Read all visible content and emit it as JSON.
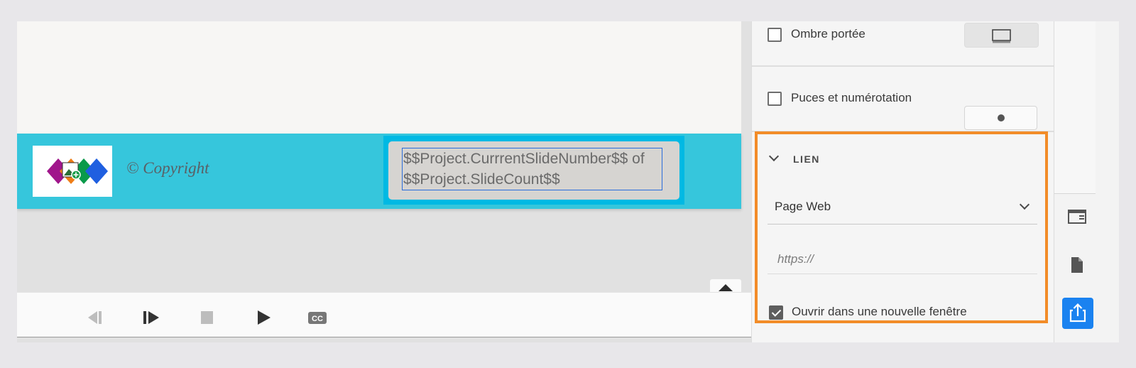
{
  "slide": {
    "copyright": "© Copyright",
    "slide_number_text": "$$Project.CurrrentSlideNumber$$ of $$Project.SlideCount$$"
  },
  "playbar": {
    "buttons": [
      "rewind-icon",
      "play-pause-icon",
      "stop-icon",
      "play-icon",
      "closed-caption-icon"
    ],
    "cc_label": "CC"
  },
  "panel": {
    "shadow": {
      "label": "Ombre portée",
      "checked": false
    },
    "bullets": {
      "label": "Puces et numérotation",
      "checked": false
    },
    "link": {
      "title": "LIEN",
      "type_value": "Page Web",
      "url_placeholder": "https://",
      "url_value": "",
      "new_window_label": "Ouvrir dans une nouvelle fenêtre",
      "new_window_checked": true
    }
  },
  "rail": {
    "icons": [
      "properties-panel-icon",
      "document-icon",
      "share-icon"
    ]
  },
  "colors": {
    "footer_band": "#36c6dc",
    "slide_number_frame": "#00b9e3",
    "highlight_border": "#f28c28",
    "share_button": "#1a82f0"
  }
}
